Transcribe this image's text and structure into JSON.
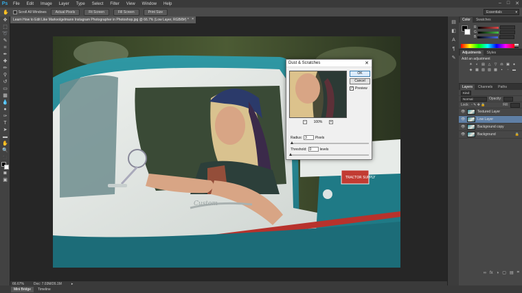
{
  "app": {
    "logo": "Ps"
  },
  "menu": [
    "File",
    "Edit",
    "Image",
    "Layer",
    "Type",
    "Select",
    "Filter",
    "View",
    "Window",
    "Help"
  ],
  "window_controls": [
    "–",
    "□",
    "✕"
  ],
  "options_bar": {
    "scroll_all_windows": "Scroll All Windows",
    "buttons": [
      "Actual Pixels",
      "Fit Screen",
      "Fill Screen",
      "Print Size"
    ],
    "workspace": "Essentials"
  },
  "document": {
    "tab_title": "Learn How to Edit Like Markvolgelmann Instagram Photographer in Photoshop.jpg @ 66.7% (Low Layer, RGB/8#) *",
    "tab_close": "×",
    "zoom_status": "66.67%",
    "doc_info": "Doc: 7.03M/26.1M"
  },
  "bottom_tabs": [
    "Mini Bridge",
    "Timeline"
  ],
  "color_panel": {
    "tabs": [
      "Color",
      "Swatches"
    ],
    "channels": [
      "R",
      "G",
      "B"
    ],
    "channel_colors": [
      "#e24a4a",
      "#49c04a",
      "#4a6ce2"
    ]
  },
  "adjustments_panel": {
    "tabs": [
      "Adjustments",
      "Styles"
    ],
    "caption": "Add an adjustment",
    "icons": [
      "☀",
      "◐",
      "▤",
      "△",
      "▽",
      "⚖",
      "▣",
      "●",
      "◈",
      "▦",
      "▧",
      "▨",
      "▩",
      "▪",
      "▫",
      "▬"
    ]
  },
  "layers_panel": {
    "tabs": [
      "Layers",
      "Channels",
      "Paths"
    ],
    "kind_filter": "Kind",
    "blend_mode": "Normal",
    "opacity_label": "Opacity:",
    "lock_label": "Lock:",
    "fill_label": "Fill:",
    "layers": [
      {
        "name": "Textured Layer",
        "selected": false
      },
      {
        "name": "Low Layer",
        "selected": true
      },
      {
        "name": "Background copy",
        "selected": false
      },
      {
        "name": "Background",
        "selected": false
      }
    ],
    "footer_icons": [
      "∞",
      "fx",
      "◑",
      "▢",
      "▤",
      "⌗"
    ]
  },
  "dialog": {
    "title": "Dust & Scratches",
    "close": "✕",
    "ok_label": "OK",
    "cancel_label": "Cancel",
    "preview_label": "Preview",
    "preview_checked": true,
    "zoom_value": "100%",
    "zoom_minus": "−",
    "zoom_plus": "+",
    "radius_label": "Radius:",
    "radius_value": "3",
    "radius_unit": "Pixels",
    "radius_level": 0.02,
    "threshold_label": "Threshold:",
    "threshold_value": "0",
    "threshold_unit": "levels",
    "threshold_level": 0.0
  },
  "photo": {
    "emblem_text": "TRACTOR SUPPLY",
    "truck_script": "Custom"
  }
}
